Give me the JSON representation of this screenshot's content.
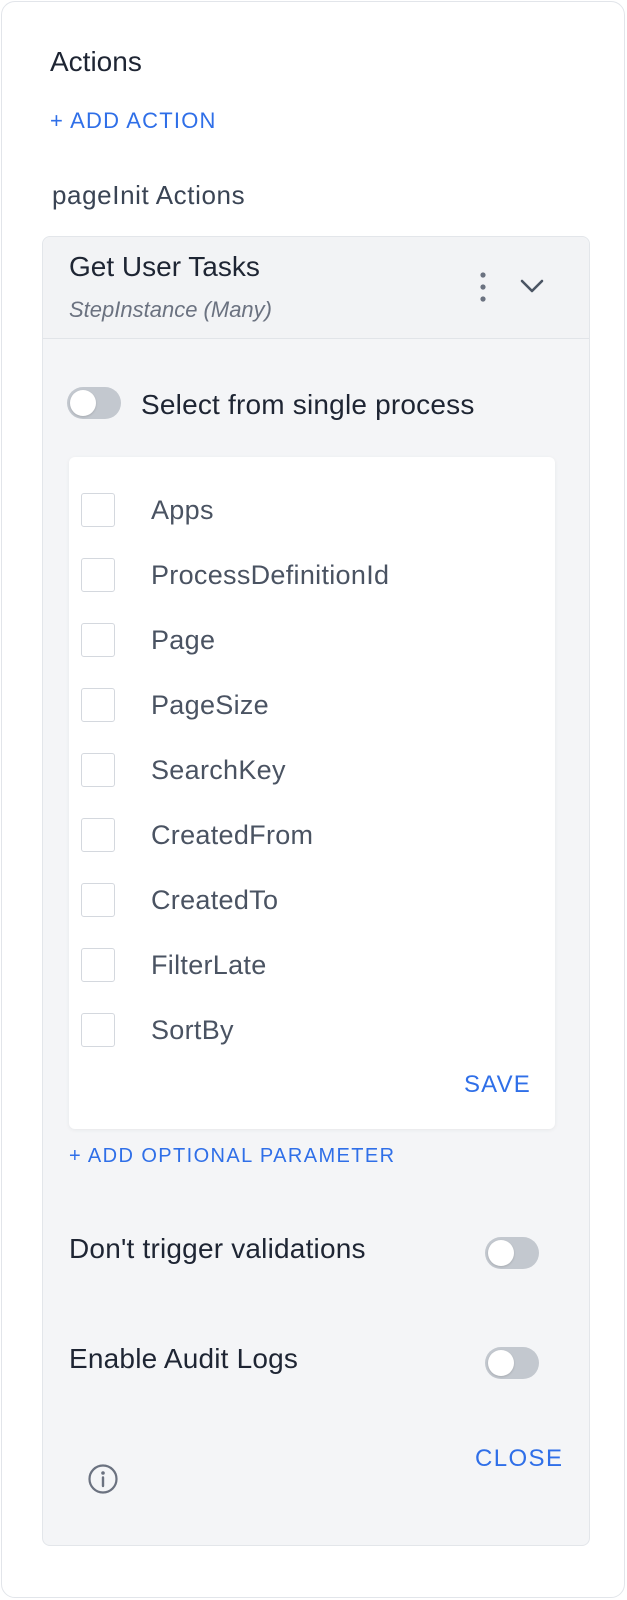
{
  "actions_panel": {
    "title": "Actions",
    "add_action_label": "+ ADD ACTION",
    "section_title": "pageInit Actions"
  },
  "action_card": {
    "title": "Get User Tasks",
    "subtitle": "StepInstance (Many)",
    "menu_icon": "kebab-vertical-icon",
    "expand_icon": "chevron-down-icon",
    "single_process": {
      "label": "Select from single process",
      "checked": false
    },
    "parameters": [
      {
        "label": "Apps",
        "checked": false
      },
      {
        "label": "ProcessDefinitionId",
        "checked": false
      },
      {
        "label": "Page",
        "checked": false
      },
      {
        "label": "PageSize",
        "checked": false
      },
      {
        "label": "SearchKey",
        "checked": false
      },
      {
        "label": "CreatedFrom",
        "checked": false
      },
      {
        "label": "CreatedTo",
        "checked": false
      },
      {
        "label": "FilterLate",
        "checked": false
      },
      {
        "label": "SortBy",
        "checked": false
      }
    ],
    "save_label": "SAVE",
    "add_optional_label": "+ ADD OPTIONAL PARAMETER",
    "dont_trigger_validations": {
      "label": "Don't trigger validations",
      "checked": false
    },
    "enable_audit_logs": {
      "label": "Enable Audit Logs",
      "checked": false
    },
    "info_icon": "info-circle-icon",
    "close_label": "CLOSE"
  },
  "colors": {
    "accent": "#2f6fe8",
    "toggle_off": "#c3c8cf",
    "card_bg": "#f4f5f7"
  }
}
